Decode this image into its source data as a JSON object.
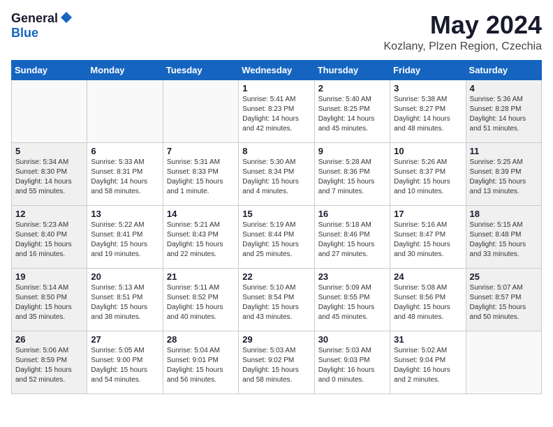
{
  "header": {
    "logo_general": "General",
    "logo_blue": "Blue",
    "month_year": "May 2024",
    "location": "Kozlany, Plzen Region, Czechia"
  },
  "days_of_week": [
    "Sunday",
    "Monday",
    "Tuesday",
    "Wednesday",
    "Thursday",
    "Friday",
    "Saturday"
  ],
  "weeks": [
    [
      {
        "day": "",
        "info": ""
      },
      {
        "day": "",
        "info": ""
      },
      {
        "day": "",
        "info": ""
      },
      {
        "day": "1",
        "info": "Sunrise: 5:41 AM\nSunset: 8:23 PM\nDaylight: 14 hours\nand 42 minutes."
      },
      {
        "day": "2",
        "info": "Sunrise: 5:40 AM\nSunset: 8:25 PM\nDaylight: 14 hours\nand 45 minutes."
      },
      {
        "day": "3",
        "info": "Sunrise: 5:38 AM\nSunset: 8:27 PM\nDaylight: 14 hours\nand 48 minutes."
      },
      {
        "day": "4",
        "info": "Sunrise: 5:36 AM\nSunset: 8:28 PM\nDaylight: 14 hours\nand 51 minutes."
      }
    ],
    [
      {
        "day": "5",
        "info": "Sunrise: 5:34 AM\nSunset: 8:30 PM\nDaylight: 14 hours\nand 55 minutes."
      },
      {
        "day": "6",
        "info": "Sunrise: 5:33 AM\nSunset: 8:31 PM\nDaylight: 14 hours\nand 58 minutes."
      },
      {
        "day": "7",
        "info": "Sunrise: 5:31 AM\nSunset: 8:33 PM\nDaylight: 15 hours\nand 1 minute."
      },
      {
        "day": "8",
        "info": "Sunrise: 5:30 AM\nSunset: 8:34 PM\nDaylight: 15 hours\nand 4 minutes."
      },
      {
        "day": "9",
        "info": "Sunrise: 5:28 AM\nSunset: 8:36 PM\nDaylight: 15 hours\nand 7 minutes."
      },
      {
        "day": "10",
        "info": "Sunrise: 5:26 AM\nSunset: 8:37 PM\nDaylight: 15 hours\nand 10 minutes."
      },
      {
        "day": "11",
        "info": "Sunrise: 5:25 AM\nSunset: 8:39 PM\nDaylight: 15 hours\nand 13 minutes."
      }
    ],
    [
      {
        "day": "12",
        "info": "Sunrise: 5:23 AM\nSunset: 8:40 PM\nDaylight: 15 hours\nand 16 minutes."
      },
      {
        "day": "13",
        "info": "Sunrise: 5:22 AM\nSunset: 8:41 PM\nDaylight: 15 hours\nand 19 minutes."
      },
      {
        "day": "14",
        "info": "Sunrise: 5:21 AM\nSunset: 8:43 PM\nDaylight: 15 hours\nand 22 minutes."
      },
      {
        "day": "15",
        "info": "Sunrise: 5:19 AM\nSunset: 8:44 PM\nDaylight: 15 hours\nand 25 minutes."
      },
      {
        "day": "16",
        "info": "Sunrise: 5:18 AM\nSunset: 8:46 PM\nDaylight: 15 hours\nand 27 minutes."
      },
      {
        "day": "17",
        "info": "Sunrise: 5:16 AM\nSunset: 8:47 PM\nDaylight: 15 hours\nand 30 minutes."
      },
      {
        "day": "18",
        "info": "Sunrise: 5:15 AM\nSunset: 8:48 PM\nDaylight: 15 hours\nand 33 minutes."
      }
    ],
    [
      {
        "day": "19",
        "info": "Sunrise: 5:14 AM\nSunset: 8:50 PM\nDaylight: 15 hours\nand 35 minutes."
      },
      {
        "day": "20",
        "info": "Sunrise: 5:13 AM\nSunset: 8:51 PM\nDaylight: 15 hours\nand 38 minutes."
      },
      {
        "day": "21",
        "info": "Sunrise: 5:11 AM\nSunset: 8:52 PM\nDaylight: 15 hours\nand 40 minutes."
      },
      {
        "day": "22",
        "info": "Sunrise: 5:10 AM\nSunset: 8:54 PM\nDaylight: 15 hours\nand 43 minutes."
      },
      {
        "day": "23",
        "info": "Sunrise: 5:09 AM\nSunset: 8:55 PM\nDaylight: 15 hours\nand 45 minutes."
      },
      {
        "day": "24",
        "info": "Sunrise: 5:08 AM\nSunset: 8:56 PM\nDaylight: 15 hours\nand 48 minutes."
      },
      {
        "day": "25",
        "info": "Sunrise: 5:07 AM\nSunset: 8:57 PM\nDaylight: 15 hours\nand 50 minutes."
      }
    ],
    [
      {
        "day": "26",
        "info": "Sunrise: 5:06 AM\nSunset: 8:59 PM\nDaylight: 15 hours\nand 52 minutes."
      },
      {
        "day": "27",
        "info": "Sunrise: 5:05 AM\nSunset: 9:00 PM\nDaylight: 15 hours\nand 54 minutes."
      },
      {
        "day": "28",
        "info": "Sunrise: 5:04 AM\nSunset: 9:01 PM\nDaylight: 15 hours\nand 56 minutes."
      },
      {
        "day": "29",
        "info": "Sunrise: 5:03 AM\nSunset: 9:02 PM\nDaylight: 15 hours\nand 58 minutes."
      },
      {
        "day": "30",
        "info": "Sunrise: 5:03 AM\nSunset: 9:03 PM\nDaylight: 16 hours\nand 0 minutes."
      },
      {
        "day": "31",
        "info": "Sunrise: 5:02 AM\nSunset: 9:04 PM\nDaylight: 16 hours\nand 2 minutes."
      },
      {
        "day": "",
        "info": ""
      }
    ]
  ]
}
